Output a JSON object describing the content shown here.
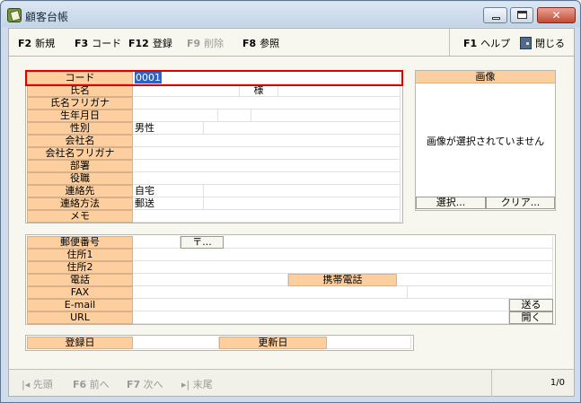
{
  "window": {
    "title": "顧客台帳"
  },
  "toolbar": {
    "items": [
      {
        "key": "F2",
        "label": "新規"
      },
      {
        "key": "F3",
        "label": "コード"
      },
      {
        "key": "F12",
        "label": "登録"
      },
      {
        "key": "F9",
        "label": "削除"
      },
      {
        "key": "F8",
        "label": "参照"
      }
    ],
    "help": {
      "key": "F1",
      "label": "ヘルプ"
    },
    "close_label": "閉じる"
  },
  "customer": {
    "code_label": "コード",
    "code_value": "0001",
    "name_label": "氏名",
    "honorific": "様",
    "name_kana_label": "氏名フリガナ",
    "birthdate_label": "生年月日",
    "gender_label": "性別",
    "gender_value": "男性",
    "company_label": "会社名",
    "company_kana_label": "会社名フリガナ",
    "department_label": "部署",
    "position_label": "役職",
    "contact_label": "連絡先",
    "contact_value": "自宅",
    "contact_method_label": "連絡方法",
    "contact_method_value": "郵送",
    "memo_label": "メモ"
  },
  "image": {
    "header": "画像",
    "empty_text": "画像が選択されていません",
    "select_button": "選択...",
    "clear_button": "クリア..."
  },
  "address": {
    "postal_label": "郵便番号",
    "postal_button": "〒...",
    "address1_label": "住所1",
    "address2_label": "住所2",
    "phone_label": "電話",
    "mobile_label": "携帯電話",
    "fax_label": "FAX",
    "email_label": "E-mail",
    "send_button": "送る",
    "url_label": "URL",
    "open_button": "開く"
  },
  "dates": {
    "registered_label": "登録日",
    "updated_label": "更新日"
  },
  "navigation": {
    "first_label": "先頭",
    "prev_key": "F6",
    "prev_label": "前へ",
    "next_key": "F7",
    "next_label": "次へ",
    "last_label": "末尾",
    "record_position": "1/0"
  }
}
